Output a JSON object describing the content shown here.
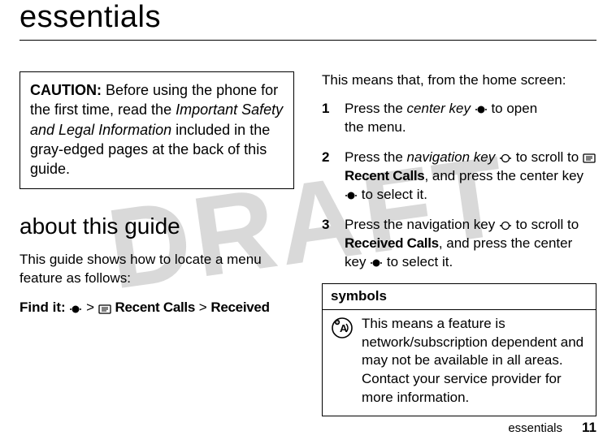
{
  "watermark": "DRAFT",
  "title": "essentials",
  "caution": {
    "label": "CAUTION:",
    "before": " Before using the phone for the first time, read the ",
    "italic": "Important Safety and Legal Information",
    "after": " included in the gray-edged pages at the back of this guide."
  },
  "about": {
    "heading": "about this guide",
    "intro": "This guide shows how to locate a menu feature as follows:",
    "findit_label": "Find it:",
    "gt": ">",
    "recent_calls": "Recent Calls",
    "received": "Received"
  },
  "right": {
    "intro": "This means that, from the home screen:",
    "steps": {
      "s1a": "Press the ",
      "s1_center_key": "center key",
      "s1b": " to open the menu.",
      "s2a": "Press the ",
      "s2_nav_key": "navigation key",
      "s2b": " to scroll to ",
      "s2_recent": "Recent Calls",
      "s2c": ", and press the center key ",
      "s2d": " to select it.",
      "s3a": "Press the navigation key ",
      "s3b": " to scroll to ",
      "s3_received": "Received Calls",
      "s3c": ", and press the center key ",
      "s3d": " to select it."
    }
  },
  "symbols": {
    "heading": "symbols",
    "text": "This means a feature is network/subscription dependent and may not be available in all areas. Contact your service provider for more information."
  },
  "footer": {
    "section": "essentials",
    "page": "11"
  }
}
